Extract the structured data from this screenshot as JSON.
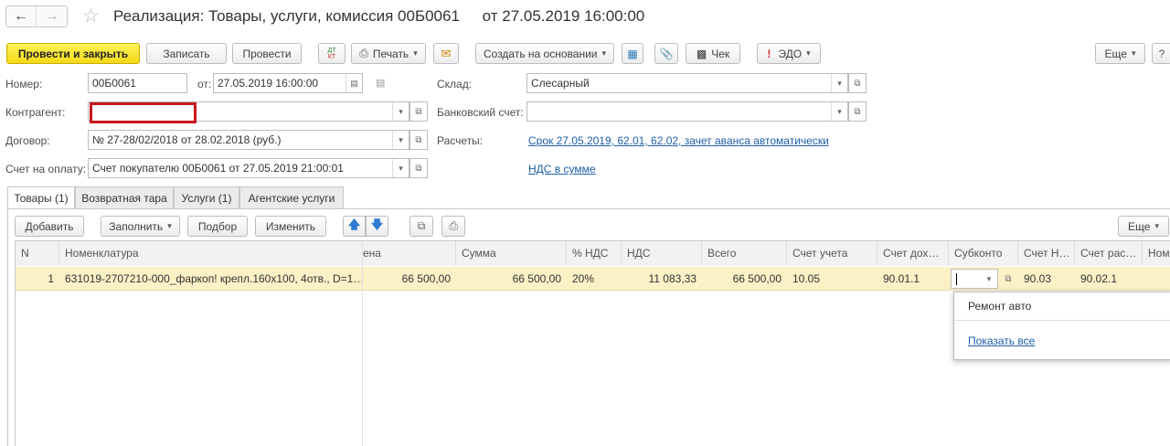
{
  "window": {
    "title": "Реализация: Товары, услуги, комиссия 00Б0061",
    "date_text": "от 27.05.2019 16:00:00"
  },
  "toolbar": {
    "post_close": "Провести и закрыть",
    "save": "Записать",
    "post": "Провести",
    "dt_kt": "ДтКт",
    "print": "Печать",
    "create_based": "Создать на основании",
    "check": "Чек",
    "edo": "ЭДО",
    "more": "Еще"
  },
  "form": {
    "number_label": "Номер:",
    "number_value": "00Б0061",
    "from_label": "от:",
    "date_value": "27.05.2019 16:00:00",
    "warehouse_label": "Склад:",
    "warehouse_value": "Слесарный",
    "counterparty_label": "Контрагент:",
    "counterparty_value": "",
    "bank_label": "Банковский счет:",
    "bank_value": "",
    "contract_label": "Договор:",
    "contract_value": "№ 27-28/02/2018 от 28.02.2018 (руб.)",
    "settlements_label": "Расчеты:",
    "settlements_link": "Срок 27.05.2019, 62.01, 62.02, зачет аванса автоматически",
    "invoice_label": "Счет на оплату:",
    "invoice_value": "Счет покупателю 00Б0061 от 27.05.2019 21:00:01",
    "vat_link": "НДС в сумме"
  },
  "tabs": [
    {
      "label": "Товары (1)"
    },
    {
      "label": "Возвратная тара"
    },
    {
      "label": "Услуги (1)"
    },
    {
      "label": "Агентские услуги"
    }
  ],
  "table_toolbar": {
    "add": "Добавить",
    "fill": "Заполнить",
    "select": "Подбор",
    "change": "Изменить",
    "more": "Еще"
  },
  "table": {
    "headers": [
      "N",
      "Номенклатура",
      "Цена",
      "Сумма",
      "% НДС",
      "НДС",
      "Всего",
      "Счет учета",
      "Счет дох…",
      "Субконто",
      "Счет Н…",
      "Счет рас…",
      "Ном"
    ],
    "header_price_visible": "ена",
    "rows": [
      {
        "n": "1",
        "item": "631019-2707210-000_фаркоп! крепл.160x100, 4отв., D=1…",
        "price": "66 500,00",
        "sum": "66 500,00",
        "vat_rate": "20%",
        "vat": "11 083,33",
        "total": "66 500,00",
        "account": "10.05",
        "income_account": "90.01.1",
        "subconto": "",
        "vat_account": "90.03",
        "expense_account": "90.02.1"
      }
    ]
  },
  "popup": {
    "item": "Ремонт авто",
    "show_all": "Показать все"
  }
}
